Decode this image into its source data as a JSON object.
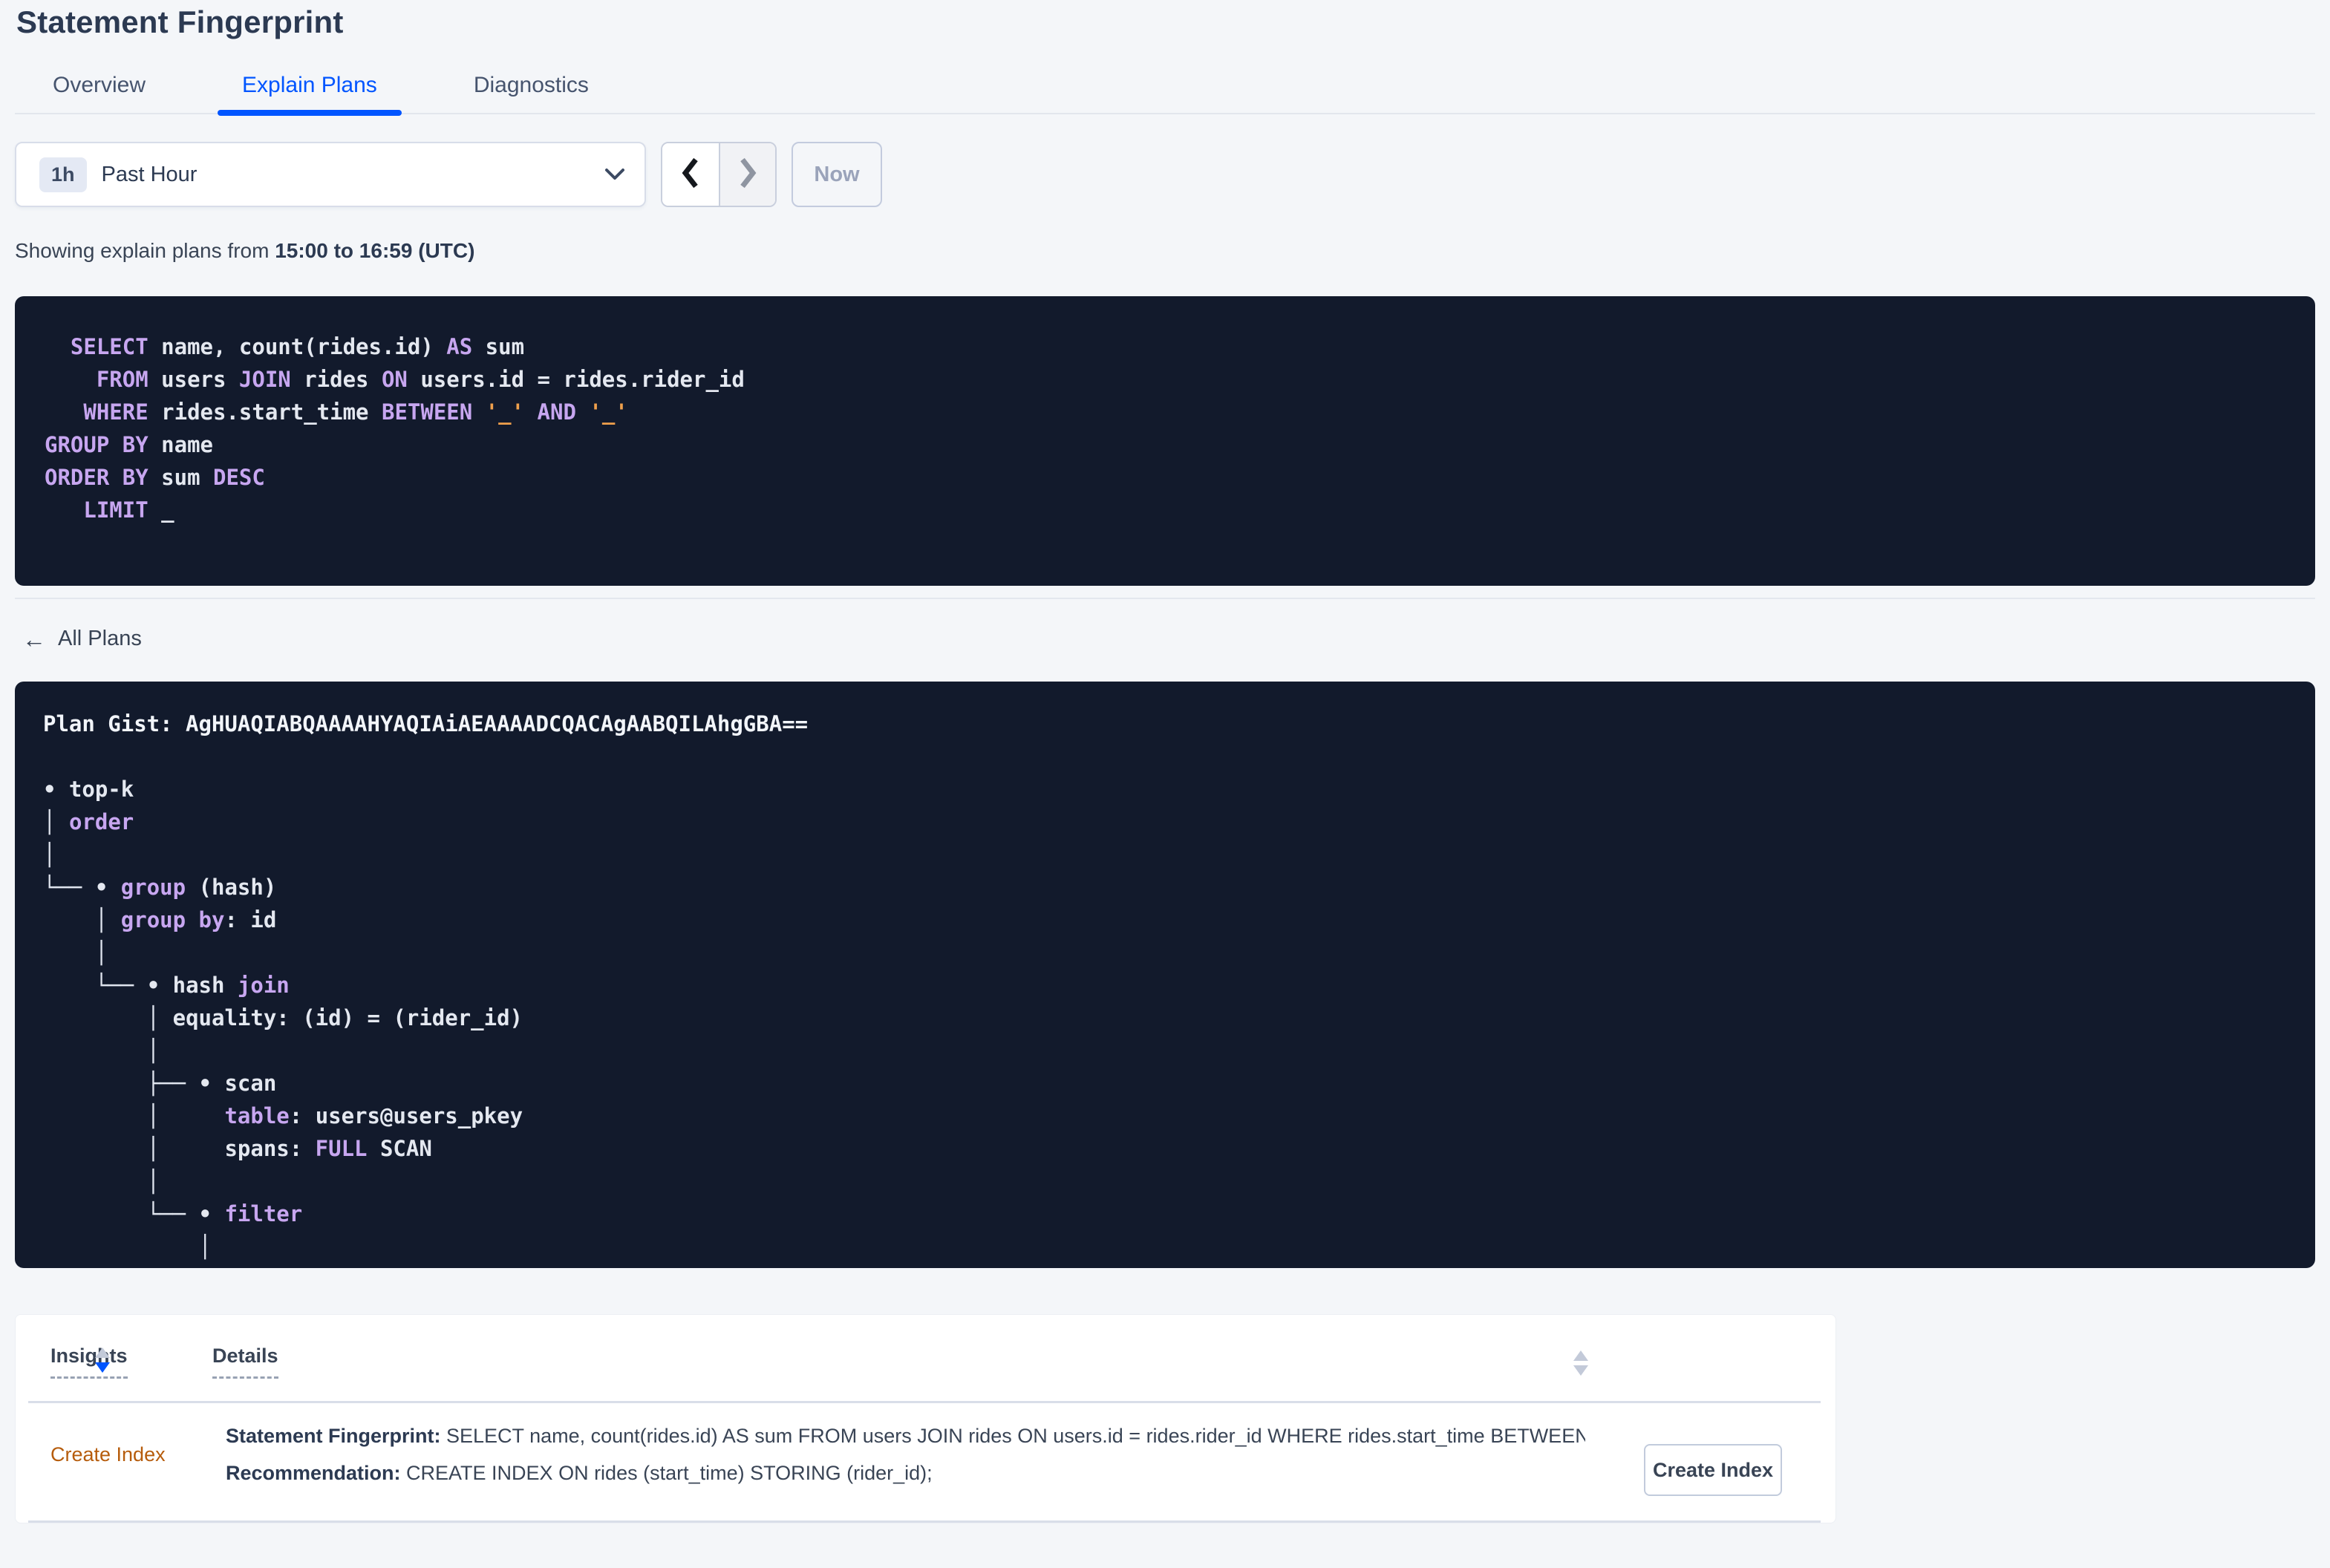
{
  "page": {
    "title": "Statement Fingerprint"
  },
  "tabs": [
    {
      "label": "Overview"
    },
    {
      "label": "Explain Plans"
    },
    {
      "label": "Diagnostics"
    }
  ],
  "timebar": {
    "range_badge": "1h",
    "range_label": "Past Hour",
    "now_label": "Now"
  },
  "showing": {
    "prefix": "Showing explain plans from ",
    "bold_range": "15:00 to 16:59 (UTC)"
  },
  "sql_lines": [
    [
      [
        "pl",
        "  "
      ],
      [
        "kw",
        "SELECT"
      ],
      [
        "pl",
        " name, count(rides.id) "
      ],
      [
        "kw",
        "AS"
      ],
      [
        "pl",
        " sum"
      ]
    ],
    [
      [
        "pl",
        "    "
      ],
      [
        "kw",
        "FROM"
      ],
      [
        "pl",
        " users "
      ],
      [
        "kw",
        "JOIN"
      ],
      [
        "pl",
        " rides "
      ],
      [
        "kw",
        "ON"
      ],
      [
        "pl",
        " users.id = rides.rider_id"
      ]
    ],
    [
      [
        "pl",
        "   "
      ],
      [
        "kw",
        "WHERE"
      ],
      [
        "pl",
        " rides.start_time "
      ],
      [
        "kw",
        "BETWEEN"
      ],
      [
        "pl",
        " "
      ],
      [
        "lit",
        "'_'"
      ],
      [
        "pl",
        " "
      ],
      [
        "kw",
        "AND"
      ],
      [
        "pl",
        " "
      ],
      [
        "lit",
        "'_'"
      ]
    ],
    [
      [
        "kw",
        "GROUP BY"
      ],
      [
        "pl",
        " name"
      ]
    ],
    [
      [
        "kw",
        "ORDER BY"
      ],
      [
        "pl",
        " sum "
      ],
      [
        "kw",
        "DESC"
      ]
    ],
    [
      [
        "pl",
        "   "
      ],
      [
        "kw",
        "LIMIT"
      ],
      [
        "pl",
        " _"
      ]
    ]
  ],
  "all_plans_label": "All Plans",
  "plan_gist_lines": [
    [
      [
        "hdr",
        "Plan Gist: AgHUAQIABQAAAAHYAQIAiAEAAAADCQACAgAABQILAhgGBA=="
      ]
    ],
    [],
    [
      [
        "pl",
        "• top-k"
      ]
    ],
    [
      [
        "tree",
        "│"
      ],
      [
        "pl",
        " "
      ],
      [
        "kw",
        "order"
      ]
    ],
    [
      [
        "tree",
        "│"
      ]
    ],
    [
      [
        "tree",
        "└── "
      ],
      [
        "pl",
        "• "
      ],
      [
        "kw",
        "group"
      ],
      [
        "pl",
        " (hash)"
      ]
    ],
    [
      [
        "pl",
        "    "
      ],
      [
        "tree",
        "│"
      ],
      [
        "pl",
        " "
      ],
      [
        "kw",
        "group by"
      ],
      [
        "pl",
        ": id"
      ]
    ],
    [
      [
        "pl",
        "    "
      ],
      [
        "tree",
        "│"
      ]
    ],
    [
      [
        "pl",
        "    "
      ],
      [
        "tree",
        "└── "
      ],
      [
        "pl",
        "• hash "
      ],
      [
        "kw",
        "join"
      ]
    ],
    [
      [
        "pl",
        "        "
      ],
      [
        "tree",
        "│"
      ],
      [
        "pl",
        " equality: (id) = (rider_id)"
      ]
    ],
    [
      [
        "pl",
        "        "
      ],
      [
        "tree",
        "│"
      ]
    ],
    [
      [
        "pl",
        "        "
      ],
      [
        "tree",
        "├── "
      ],
      [
        "pl",
        "• scan"
      ]
    ],
    [
      [
        "pl",
        "        "
      ],
      [
        "tree",
        "│"
      ],
      [
        "pl",
        "     "
      ],
      [
        "kw",
        "table"
      ],
      [
        "pl",
        ": users@users_pkey"
      ]
    ],
    [
      [
        "pl",
        "        "
      ],
      [
        "tree",
        "│"
      ],
      [
        "pl",
        "     spans: "
      ],
      [
        "kw",
        "FULL"
      ],
      [
        "pl",
        " SCAN"
      ]
    ],
    [
      [
        "pl",
        "        "
      ],
      [
        "tree",
        "│"
      ]
    ],
    [
      [
        "pl",
        "        "
      ],
      [
        "tree",
        "└── "
      ],
      [
        "pl",
        "• "
      ],
      [
        "kw",
        "filter"
      ]
    ],
    [
      [
        "pl",
        "            "
      ],
      [
        "tree",
        "│"
      ]
    ]
  ],
  "insights_table": {
    "columns": {
      "insights": "Insights",
      "details": "Details"
    },
    "sort_state": "desc",
    "row": {
      "insight": "Create Index",
      "detail_line1_label": "Statement Fingerprint:",
      "detail_line1_text": " SELECT name, count(rides.id) AS sum FROM users JOIN rides ON users.id = rides.rider_id WHERE rides.start_time BETWEEN '_…",
      "detail_line2_label": "Recommendation:",
      "detail_line2_text": " CREATE INDEX ON rides (start_time) STORING (rider_id);",
      "button_label": "Create Index"
    }
  },
  "colors": {
    "accent_blue": "#0055ff",
    "code_background": "#121a2c",
    "code_keyword": "#c7a6f0",
    "code_literal": "#efa04c",
    "insight_link": "#b65c0c",
    "page_background": "#f4f6f9"
  }
}
